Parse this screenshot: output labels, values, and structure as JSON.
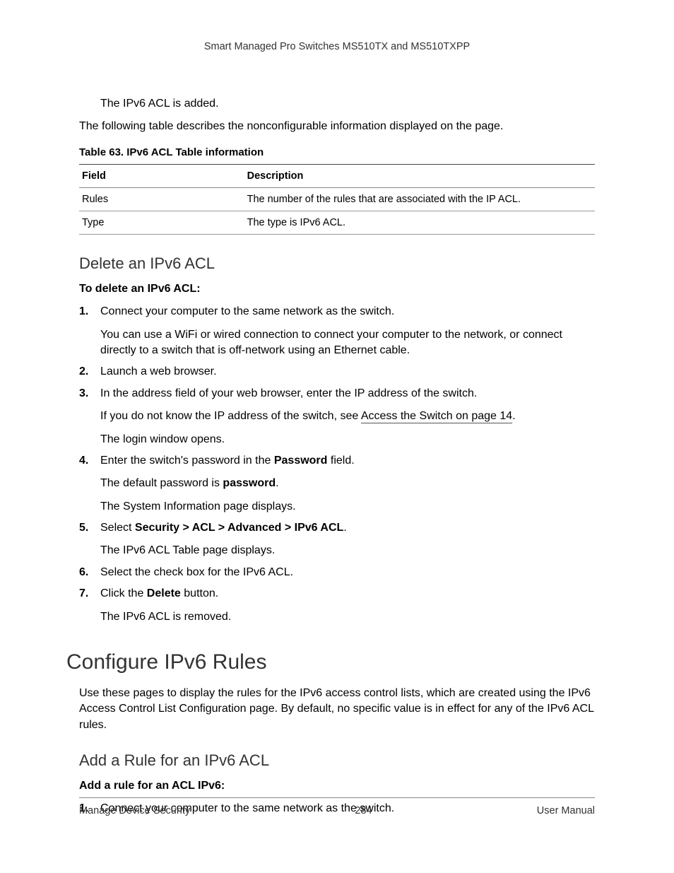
{
  "header": {
    "title": "Smart Managed Pro Switches MS510TX and MS510TXPP"
  },
  "intro": {
    "added": "The IPv6 ACL is added.",
    "table_desc": "The following table describes the nonconfigurable information displayed on the page."
  },
  "table63": {
    "caption": "Table 63.  IPv6 ACL Table information",
    "head_field": "Field",
    "head_desc": "Description",
    "rows": [
      {
        "field": "Rules",
        "desc": "The number of the rules that are associated with the IP ACL."
      },
      {
        "field": "Type",
        "desc": "The type is IPv6 ACL."
      }
    ]
  },
  "delete_section": {
    "heading": "Delete an IPv6 ACL",
    "lead": "To delete an IPv6 ACL:",
    "steps": {
      "s1": "Connect your computer to the same network as the switch.",
      "s1_sub": "You can use a WiFi or wired connection to connect your computer to the network, or connect directly to a switch that is off-network using an Ethernet cable.",
      "s2": "Launch a web browser.",
      "s3": "In the address field of your web browser, enter the IP address of the switch.",
      "s3_sub_pre": "If you do not know the IP address of the switch, see ",
      "s3_sub_link": "Access the Switch on page 14",
      "s3_sub_post": ".",
      "s3_sub2": "The login window opens.",
      "s4_pre": "Enter the switch's password in the ",
      "s4_bold": "Password",
      "s4_post": " field.",
      "s4_sub_pre": "The default password is ",
      "s4_sub_bold": "password",
      "s4_sub_post": ".",
      "s4_sub2": "The System Information page displays.",
      "s5_pre": "Select ",
      "s5_bold": "Security > ACL > Advanced > IPv6 ACL",
      "s5_post": ".",
      "s5_sub": "The IPv6 ACL Table page displays.",
      "s6": "Select the check box for the IPv6 ACL.",
      "s7_pre": "Click the ",
      "s7_bold": "Delete",
      "s7_post": " button.",
      "s7_sub": "The IPv6 ACL is removed."
    }
  },
  "configure_section": {
    "heading": "Configure IPv6 Rules",
    "intro": "Use these pages to display the rules for the IPv6 access control lists, which are created using the IPv6 Access Control List Configuration page. By default, no specific value is in effect for any of the IPv6 ACL rules.",
    "sub_heading": "Add a Rule for an IPv6 ACL",
    "lead": "Add a rule for an ACL IPv6:",
    "steps": {
      "s1": "Connect your computer to the same network as the switch."
    }
  },
  "footer": {
    "left": "Manage Device Security",
    "center": "284",
    "right": "User Manual"
  }
}
